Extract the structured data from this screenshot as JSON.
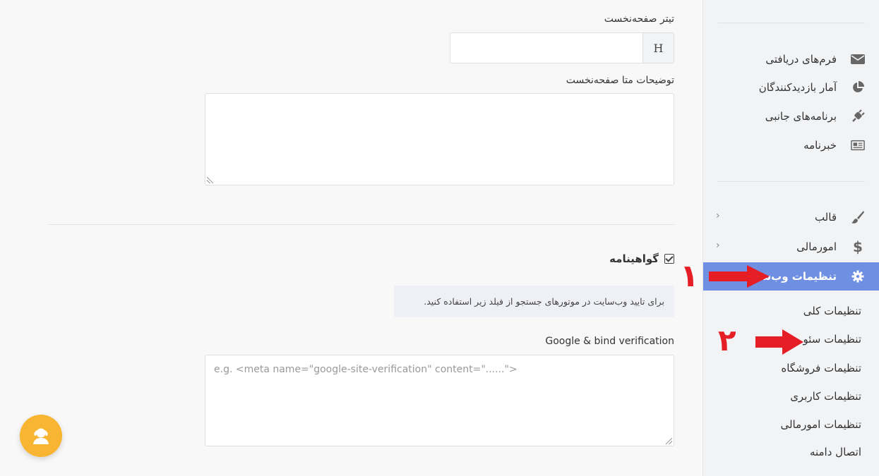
{
  "sidebar": {
    "group1": [
      {
        "label": "فرم‌های دریافتی",
        "icon": "envelope-icon"
      },
      {
        "label": "آمار بازدیدکنندگان",
        "icon": "pie-chart-icon"
      },
      {
        "label": "برنامه‌های جانبی",
        "icon": "plug-icon"
      },
      {
        "label": "خبرنامه",
        "icon": "newspaper-icon"
      }
    ],
    "group2": [
      {
        "label": "قالب",
        "icon": "brush-icon"
      },
      {
        "label": "امورمالی",
        "icon": "dollar-icon"
      },
      {
        "label": "تنظیمات وب‌سایت",
        "icon": "gear-icon"
      }
    ],
    "submenu": [
      "تنظیمات کلی",
      "تنظیمات سئو",
      "تنظیمات فروشگاه",
      "تنظیمات کاربری",
      "تنظیمات امورمالی",
      "اتصال دامنه"
    ],
    "active_color": "#6f8fe3"
  },
  "form": {
    "home_title_label": "تیتر صفحه‌نخست",
    "home_title_addon": "H",
    "home_title_value": "",
    "meta_desc_label": "توضیحات متا صفحه‌نخست",
    "meta_desc_value": "",
    "certificate_label": "گواهینامه",
    "certificate_checked": true,
    "info_text": "برای تایید وب‌سایت در موتورهای جستجو از فیلد زیر استفاده کنید.",
    "verification_label": "Google & bind verification",
    "verification_placeholder": "e.g. <meta name=\"google-site-verification\" content=\"......\">"
  },
  "annotations": {
    "step1": "۱",
    "step2": "۲",
    "color": "#e51d25"
  },
  "support": {
    "icon": "support-agent-icon",
    "color": "#f8b531"
  }
}
